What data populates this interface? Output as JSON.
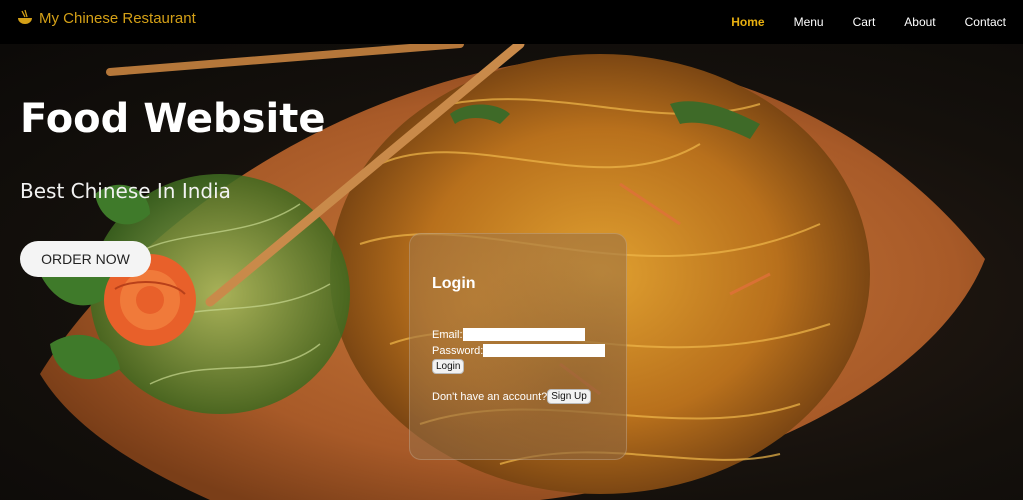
{
  "nav": {
    "brand": "My Chinese Restaurant",
    "brand_icon": "noodle-bowl-icon",
    "items": [
      {
        "label": "Home",
        "active": true
      },
      {
        "label": "Menu",
        "active": false
      },
      {
        "label": "Cart",
        "active": false
      },
      {
        "label": "About",
        "active": false
      },
      {
        "label": "Contact",
        "active": false
      }
    ]
  },
  "hero": {
    "title": "Food Website",
    "subtitle": "Best Chinese In India",
    "cta_label": "ORDER NOW"
  },
  "login": {
    "title": "Login",
    "email_label": "Email:",
    "email_value": "",
    "password_label": "Password:",
    "password_value": "",
    "login_button": "Login",
    "signup_prompt": "Don't have an account?",
    "signup_button": "Sign Up"
  },
  "colors": {
    "navbar_bg": "#000000",
    "brand": "#d4a017",
    "active_link": "#e8b010"
  }
}
